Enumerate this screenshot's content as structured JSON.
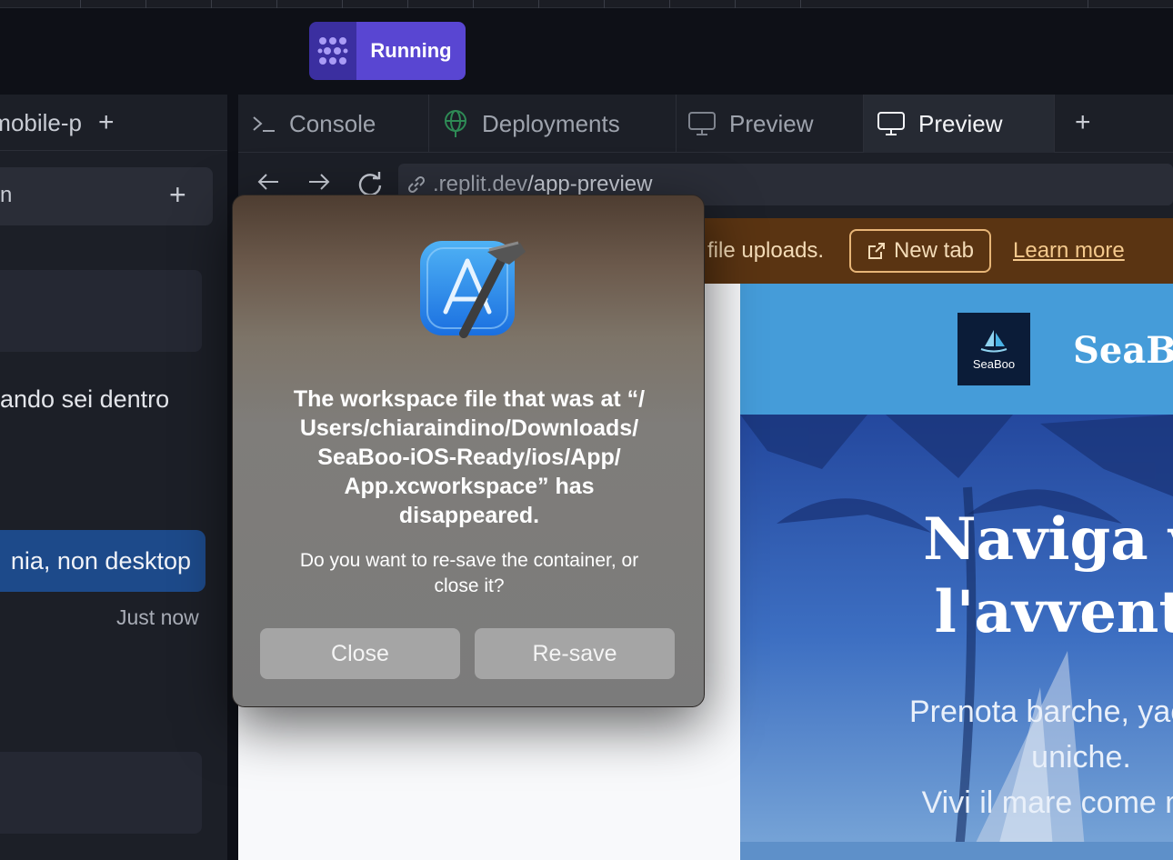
{
  "run_button": {
    "label": "Running",
    "icon": "replit-agent-icon",
    "accent": "#5946d2"
  },
  "left_panel": {
    "tab_label": "mobile-p",
    "chat_input_text": "n",
    "message_text": "ando sei dentro",
    "user_message": "nia, non desktop",
    "timestamp": "Just now"
  },
  "main_tabs": [
    {
      "label": "Console",
      "icon": "terminal-icon"
    },
    {
      "label": "Deployments",
      "icon": "globe-icon"
    },
    {
      "label": "Preview",
      "icon": "monitor-icon"
    },
    {
      "label": "Preview",
      "icon": "monitor-icon",
      "active": true
    }
  ],
  "browser": {
    "url_prefix": ".replit.dev",
    "url_path": "/app-preview"
  },
  "banner": {
    "text": "file uploads.",
    "new_tab_label": "New tab",
    "learn_more_label": "Learn more",
    "color": "#5a3412"
  },
  "site": {
    "logo_text": "SeaBoo",
    "brand": "SeaBo",
    "hero_title_line1": "Naviga ve",
    "hero_title_line2": "l'avventu",
    "hero_sub_line1": "Prenota barche, yacht e i",
    "hero_sub_line2": "uniche.",
    "hero_sub_line3": "Vivi il mare come mai p"
  },
  "dialog": {
    "icon": "xcode-icon",
    "title_line1": "The workspace file that was at “/",
    "title_line2": "Users/chiaraindino/Downloads/",
    "title_line3": "SeaBoo-iOS-Ready/ios/App/",
    "title_line4": "App.xcworkspace” has",
    "title_line5": "disappeared.",
    "message_line1": "Do you want to re-save the container, or",
    "message_line2": "close it?",
    "close_label": "Close",
    "resave_label": "Re-save"
  }
}
